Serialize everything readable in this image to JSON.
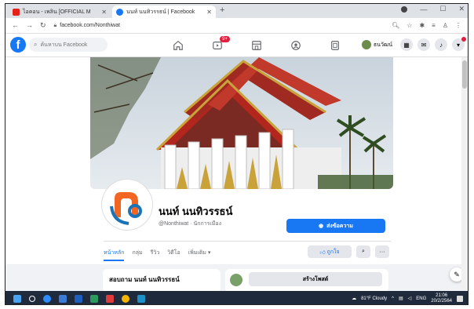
{
  "browser": {
    "tabs": [
      {
        "title": "ไอคอน - เพลิน [OFFICIAL M",
        "favicon_color": "#e62117"
      },
      {
        "title": "นนท์ นนทิวรรธน์ | Facebook",
        "favicon_color": "#1877f2"
      }
    ],
    "url": "facebook.com/Nonthiwat"
  },
  "fb": {
    "logo": "f",
    "search_placeholder": "ค้นหาบน Facebook",
    "notif_count": "9+",
    "profile_short": "ธนวัฒน์"
  },
  "profile": {
    "name": "นนท์ นนทิวรรธน์",
    "handle": "@Nonthiwat · นักการเมือง",
    "send_message": "ส่งข้อความ",
    "tabs": [
      "หน้าหลัก",
      "กลุ่ม",
      "รีวิว",
      "วิดีโอ",
      "เพิ่มเติม ▾"
    ],
    "like_label": "ถูกใจ",
    "about_title": "สอบถาม นนท์ นนทิวรรธน์",
    "create_post": "สร้างโพสต์"
  },
  "taskbar": {
    "weather": "81°F Cloudy",
    "lang": "ENG",
    "time": "21:06",
    "date": "20/2/2564"
  },
  "colors": {
    "fb_blue": "#1877f2",
    "taskbar": "#1f2b3d",
    "temple_red": "#c0392b",
    "temple_gold": "#c9a23a",
    "brand_orange": "#f26522"
  }
}
